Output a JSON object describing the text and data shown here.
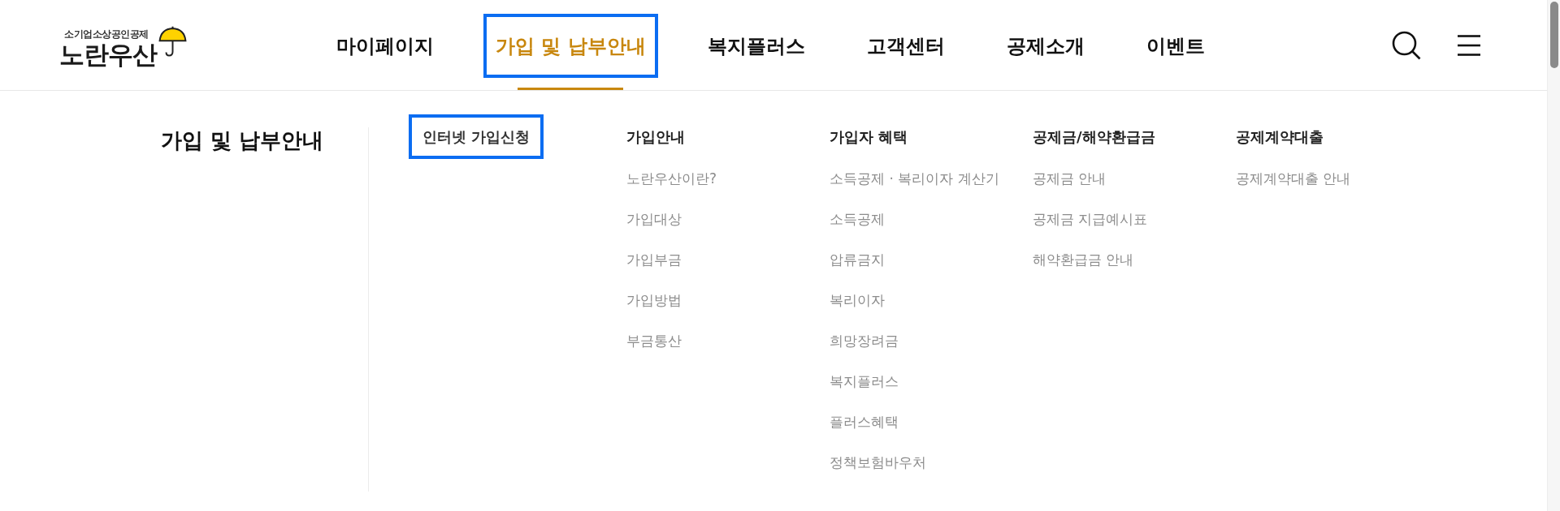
{
  "logo": {
    "tagline": "소기업소상공인공제",
    "name": "노란우산"
  },
  "nav": [
    {
      "label": "마이페이지",
      "selected": false,
      "focused": false
    },
    {
      "label": "가입 및 납부안내",
      "selected": true,
      "focused": true
    },
    {
      "label": "복지플러스",
      "selected": false,
      "focused": false
    },
    {
      "label": "고객센터",
      "selected": false,
      "focused": false
    },
    {
      "label": "공제소개",
      "selected": false,
      "focused": false
    },
    {
      "label": "이벤트",
      "selected": false,
      "focused": false
    }
  ],
  "mega_menu": {
    "title": "가입 및 납부안내",
    "featured_link": {
      "label": "인터넷 가입신청",
      "focused": true
    },
    "columns": [
      {
        "heading": "가입안내",
        "items": [
          "노란우산이란?",
          "가입대상",
          "가입부금",
          "가입방법",
          "부금통산"
        ]
      },
      {
        "heading": "가입자 혜택",
        "items": [
          "소득공제 · 복리이자 계산기",
          "소득공제",
          "압류금지",
          "복리이자",
          "희망장려금",
          "복지플러스",
          "플러스혜택",
          "정책보험바우처"
        ]
      },
      {
        "heading": "공제금/해약환급금",
        "items": [
          "공제금 안내",
          "공제금 지급예시표",
          "해약환급금 안내"
        ]
      },
      {
        "heading": "공제계약대출",
        "items": [
          "공제계약대출 안내"
        ]
      }
    ]
  }
}
